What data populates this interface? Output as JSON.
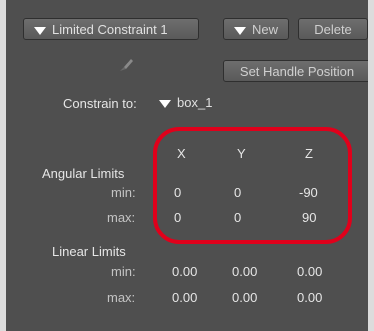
{
  "constraint_dropdown_label": "Limited Constraint 1",
  "new_button_label": "New",
  "delete_button_label": "Delete",
  "set_handle_button_label": "Set Handle Position",
  "constrain_to": {
    "label": "Constrain to:",
    "value": "box_1"
  },
  "columns": [
    "X",
    "Y",
    "Z"
  ],
  "angular_limits": {
    "title": "Angular Limits",
    "min_label": "min:",
    "max_label": "max:",
    "min": [
      "0",
      "0",
      "-90"
    ],
    "max": [
      "0",
      "0",
      "90"
    ]
  },
  "linear_limits": {
    "title": "Linear Limits",
    "min_label": "min:",
    "max_label": "max:",
    "min": [
      "0.00",
      "0.00",
      "0.00"
    ],
    "max": [
      "0.00",
      "0.00",
      "0.00"
    ]
  },
  "colors": {
    "highlight": "#e0001b",
    "panel": "#4f4f4f"
  }
}
